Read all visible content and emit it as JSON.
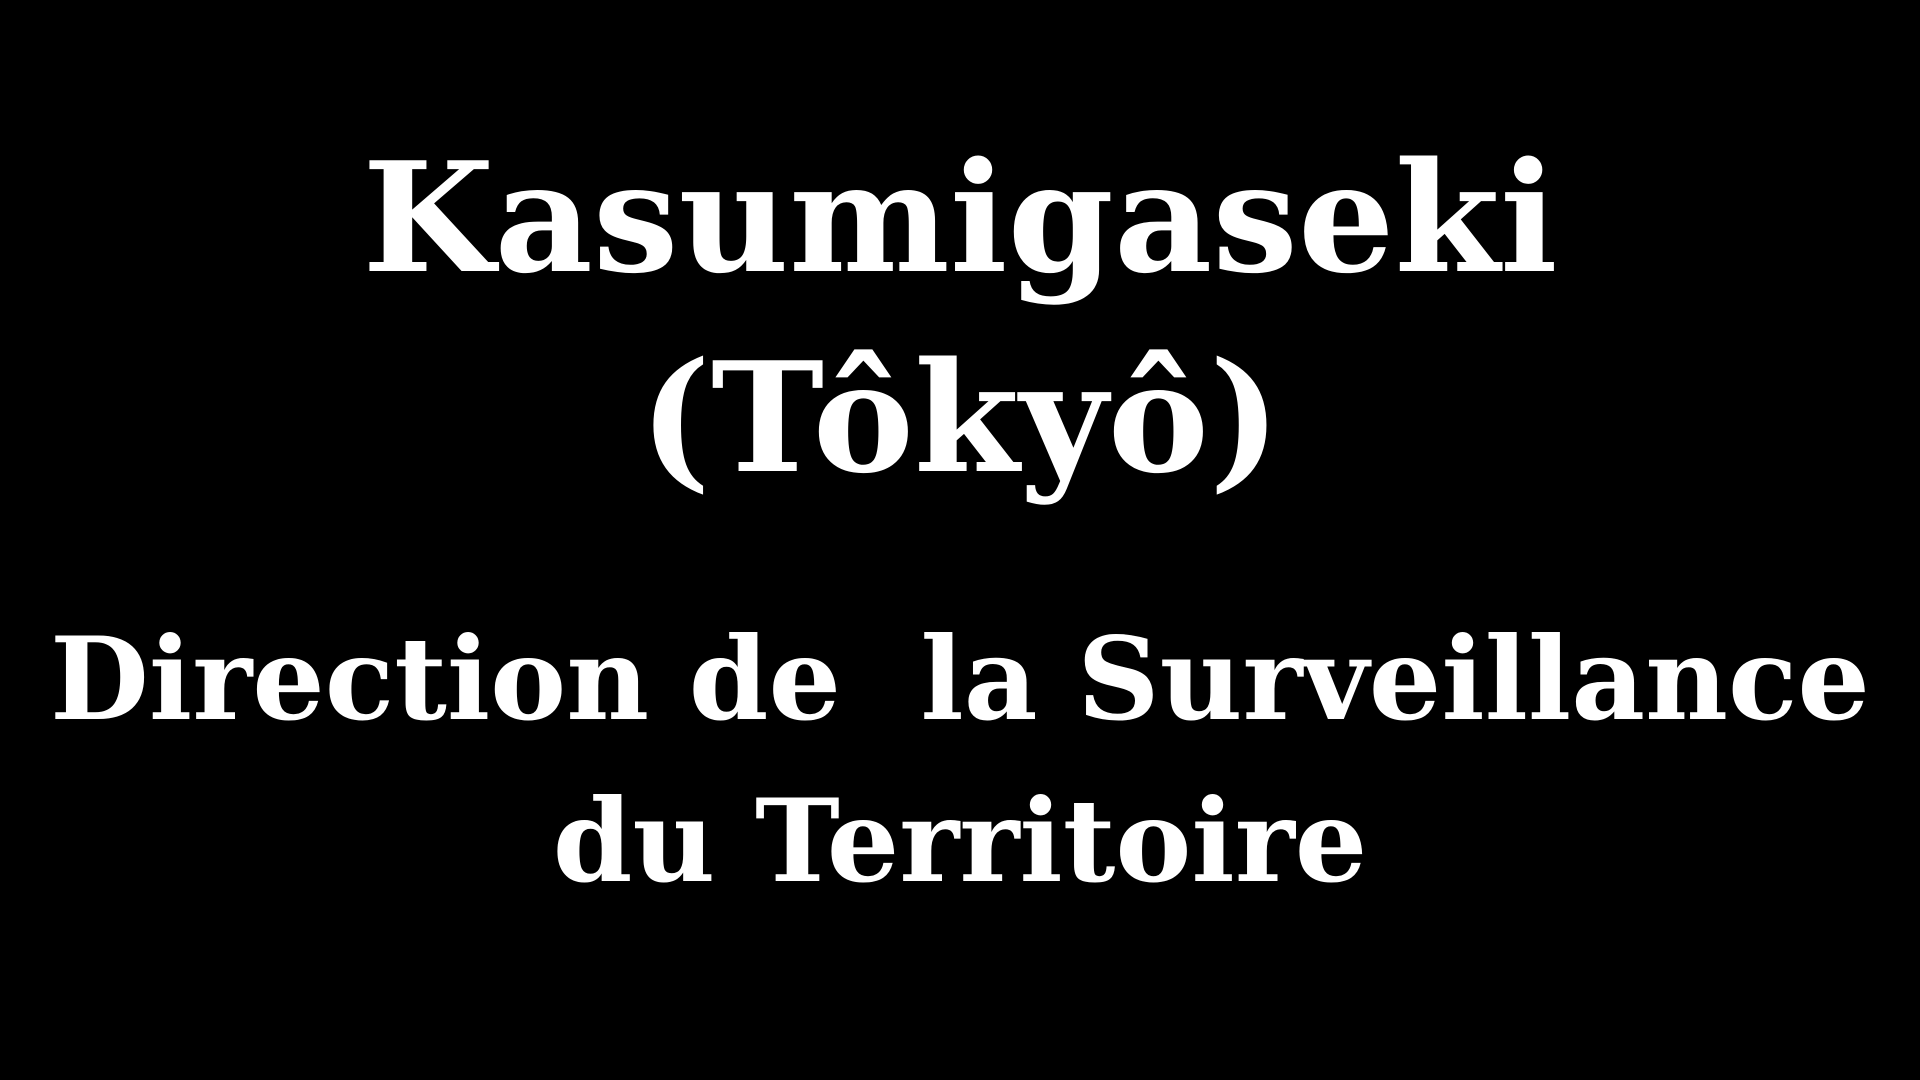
{
  "title": {
    "line1": "Kasumigaseki",
    "line2": "(Tôkyô)"
  },
  "subtitle": {
    "line1": "Direction de  la Surveillance",
    "line2": "du Territoire"
  },
  "colors": {
    "background": "#000000",
    "text": "#ffffff"
  }
}
